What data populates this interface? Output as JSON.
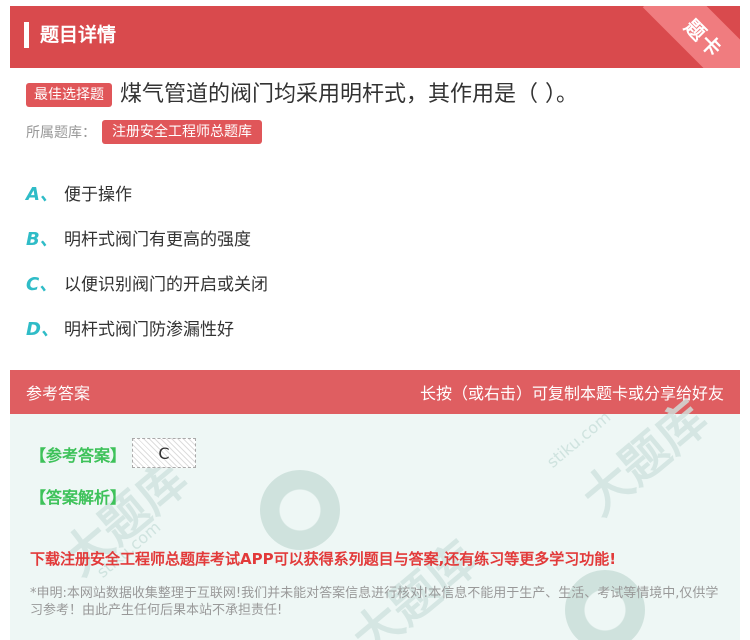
{
  "header": {
    "title": "题目详情",
    "corner_label": "题卡"
  },
  "question": {
    "type_tag": "最佳选择题",
    "text": "煤气管道的阀门均采用明杆式，其作用是（ ）。",
    "bank_label": "所属题库：",
    "bank_name": "注册安全工程师总题库"
  },
  "options": [
    {
      "letter": "A、",
      "text": "便于操作"
    },
    {
      "letter": "B、",
      "text": "明杆式阀门有更高的强度"
    },
    {
      "letter": "C、",
      "text": "以便识别阀门的开启或关闭"
    },
    {
      "letter": "D、",
      "text": "明杆式阀门防渗漏性好"
    }
  ],
  "answer": {
    "head_left": "参考答案",
    "head_right": "长按（或右击）可复制本题卡或分享给好友",
    "answer_label": "【参考答案】",
    "answer_value": "C",
    "analysis_label": "【答案解析】",
    "promo": "下载注册安全工程师总题库考试APP可以获得系列题目与答案,还有练习等更多学习功能!",
    "disclaimer": "*申明:本网站数据收集整理于互联网!我们并未能对答案信息进行核对!本信息不能用于生产、生活、考试等情境中,仅供学习参考！由此产生任何后果本站不承担责任!"
  },
  "watermark": {
    "text": "大题库",
    "url": "stiku.com"
  }
}
